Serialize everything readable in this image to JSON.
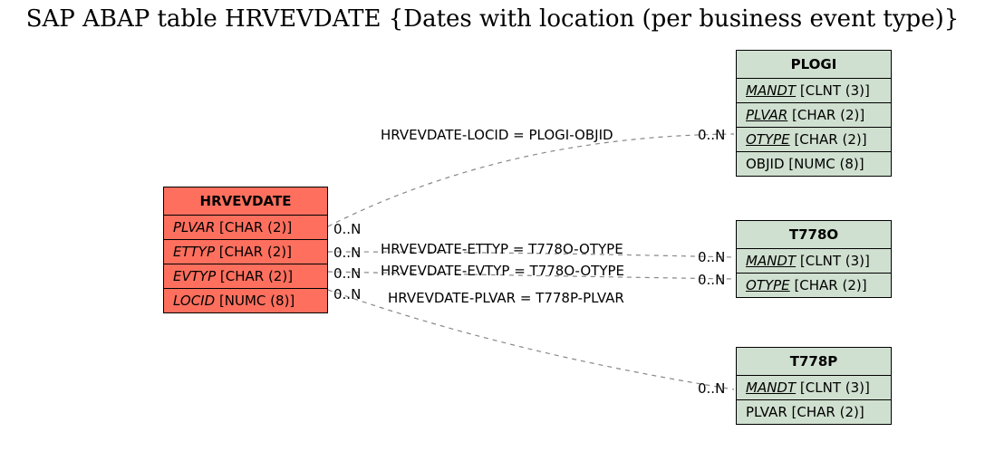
{
  "title": "SAP ABAP table HRVEVDATE {Dates with location (per business event type)}",
  "entities": {
    "main": {
      "name": "HRVEVDATE",
      "fields": [
        {
          "name": "PLVAR",
          "type": "[CHAR (2)]"
        },
        {
          "name": "ETTYP",
          "type": "[CHAR (2)]"
        },
        {
          "name": "EVTYP",
          "type": "[CHAR (2)]"
        },
        {
          "name": "LOCID",
          "type": "[NUMC (8)]"
        }
      ]
    },
    "plogi": {
      "name": "PLOGI",
      "fields": [
        {
          "name": "MANDT",
          "type": "[CLNT (3)]",
          "key": true
        },
        {
          "name": "PLVAR",
          "type": "[CHAR (2)]",
          "key": true
        },
        {
          "name": "OTYPE",
          "type": "[CHAR (2)]",
          "key": true
        },
        {
          "name": "OBJID",
          "type": "[NUMC (8)]"
        }
      ]
    },
    "t778o": {
      "name": "T778O",
      "fields": [
        {
          "name": "MANDT",
          "type": "[CLNT (3)]",
          "key": true
        },
        {
          "name": "OTYPE",
          "type": "[CHAR (2)]",
          "key": true
        }
      ]
    },
    "t778p": {
      "name": "T778P",
      "fields": [
        {
          "name": "MANDT",
          "type": "[CLNT (3)]",
          "key": true
        },
        {
          "name": "PLVAR",
          "type": "[CHAR (2)]"
        }
      ]
    }
  },
  "relations": {
    "r1": "HRVEVDATE-LOCID = PLOGI-OBJID",
    "r2": "HRVEVDATE-ETTYP = T778O-OTYPE",
    "r3": "HRVEVDATE-EVTYP = T778O-OTYPE",
    "r4": "HRVEVDATE-PLVAR = T778P-PLVAR"
  },
  "card": {
    "zn": "0..N"
  }
}
